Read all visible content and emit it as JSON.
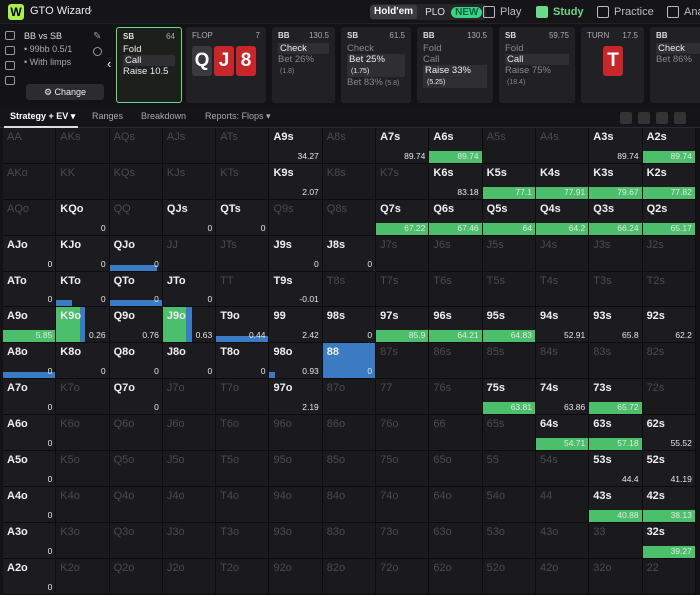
{
  "app": {
    "title": "GTO Wizard",
    "game_types": [
      "Hold'em",
      "PLO"
    ],
    "new_badge": "NEW",
    "nav": [
      {
        "label": "Play"
      },
      {
        "label": "Study",
        "active": true
      },
      {
        "label": "Practice"
      },
      {
        "label": "Ana"
      }
    ]
  },
  "setup": {
    "title": "BB vs SB",
    "stakes": "99bb 0.5/1",
    "limps": "With limps",
    "change": "Change"
  },
  "actions": [
    {
      "player": "SB",
      "pot": "64",
      "rows": [
        {
          "t": "Fold"
        },
        {
          "t": "Call",
          "on": true
        },
        {
          "t": "Raise 10.5"
        }
      ],
      "selected": true
    },
    {
      "player": "BB",
      "pot": "130.5",
      "rows": [
        {
          "t": "Check",
          "on": true
        },
        {
          "t": "Bet 26%",
          "s": "(1.8)"
        }
      ]
    },
    {
      "player": "SB",
      "pot": "61.5",
      "rows": [
        {
          "t": "Check"
        },
        {
          "t": "Bet 25%",
          "s": "(1.75)",
          "on": true
        },
        {
          "t": "Bet 83%",
          "s": "(5.8)"
        }
      ]
    },
    {
      "player": "BB",
      "pot": "130.5",
      "rows": [
        {
          "t": "Fold"
        },
        {
          "t": "Call"
        },
        {
          "t": "Raise 33%",
          "s": "(5.25)",
          "on": true
        }
      ]
    },
    {
      "player": "SB",
      "pot": "59.75",
      "rows": [
        {
          "t": "Fold"
        },
        {
          "t": "Call",
          "on": true
        },
        {
          "t": "Raise 75%",
          "s": "(18.4)"
        }
      ]
    },
    {
      "player": "BB",
      "pot": "",
      "rows": [
        {
          "t": "Check",
          "on": true
        },
        {
          "t": "Bet 86%"
        }
      ]
    }
  ],
  "flop": {
    "label": "FLOP",
    "pot": "7",
    "cards": [
      "Q",
      "J",
      "8"
    ]
  },
  "turn": {
    "label": "TURN",
    "pot": "17.5",
    "cards": [
      "T"
    ]
  },
  "tabs": [
    "Strategy + EV",
    "Ranges",
    "Breakdown",
    "Reports: Flops"
  ],
  "colors": {
    "call": "#4bbf6b",
    "raise": "#3a7bc4",
    "accent": "#6cd98a"
  },
  "grid": [
    [
      "AA",
      "AKs",
      "AQs",
      "AJs",
      "ATs",
      "A9s",
      "A8s",
      "A7s",
      "A6s",
      "A5s",
      "A4s",
      "A3s",
      "A2s"
    ],
    [
      "AKo",
      "KK",
      "KQs",
      "KJs",
      "KTs",
      "K9s",
      "K8s",
      "K7s",
      "K6s",
      "K5s",
      "K4s",
      "K3s",
      "K2s"
    ],
    [
      "AQo",
      "KQo",
      "QQ",
      "QJs",
      "QTs",
      "Q9s",
      "Q8s",
      "Q7s",
      "Q6s",
      "Q5s",
      "Q4s",
      "Q3s",
      "Q2s"
    ],
    [
      "AJo",
      "KJo",
      "QJo",
      "JJ",
      "JTs",
      "J9s",
      "J8s",
      "J7s",
      "J6s",
      "J5s",
      "J4s",
      "J3s",
      "J2s"
    ],
    [
      "ATo",
      "KTo",
      "QTo",
      "JTo",
      "TT",
      "T9s",
      "T8s",
      "T7s",
      "T6s",
      "T5s",
      "T4s",
      "T3s",
      "T2s"
    ],
    [
      "A9o",
      "K9o",
      "Q9o",
      "J9o",
      "T9o",
      "99",
      "98s",
      "97s",
      "96s",
      "95s",
      "94s",
      "93s",
      "92s"
    ],
    [
      "A8o",
      "K8o",
      "Q8o",
      "J8o",
      "T8o",
      "98o",
      "88",
      "87s",
      "86s",
      "85s",
      "84s",
      "83s",
      "82s"
    ],
    [
      "A7o",
      "K7o",
      "Q7o",
      "J7o",
      "T7o",
      "97o",
      "87o",
      "77",
      "76s",
      "75s",
      "74s",
      "73s",
      "72s"
    ],
    [
      "A6o",
      "K6o",
      "Q6o",
      "J6o",
      "T6o",
      "96o",
      "86o",
      "76o",
      "66",
      "65s",
      "64s",
      "63s",
      "62s"
    ],
    [
      "A5o",
      "K5o",
      "Q5o",
      "J5o",
      "T5o",
      "95o",
      "85o",
      "75o",
      "65o",
      "55",
      "54s",
      "53s",
      "52s"
    ],
    [
      "A4o",
      "K4o",
      "Q4o",
      "J4o",
      "T4o",
      "94o",
      "84o",
      "74o",
      "64o",
      "54o",
      "44",
      "43s",
      "42s"
    ],
    [
      "A3o",
      "K3o",
      "Q3o",
      "J3o",
      "T3o",
      "93o",
      "83o",
      "73o",
      "63o",
      "53o",
      "43o",
      "33",
      "32s"
    ],
    [
      "A2o",
      "K2o",
      "Q2o",
      "J2o",
      "T2o",
      "92o",
      "82o",
      "72o",
      "62o",
      "52o",
      "42o",
      "32o",
      "22"
    ]
  ],
  "hands": {
    "A9s": {
      "ev": "34.27"
    },
    "A7s": {
      "ev": "89.74"
    },
    "A6s": {
      "ev": "89.74",
      "call": 1
    },
    "A3s": {
      "ev": "89.74"
    },
    "A2s": {
      "ev": "89.74",
      "call": 1
    },
    "K9s": {
      "ev": "2.07"
    },
    "K6s": {
      "ev": "83.18"
    },
    "K5s": {
      "ev": "77.1",
      "call": 1
    },
    "K4s": {
      "ev": "77.91",
      "call": 1
    },
    "K3s": {
      "ev": "79.67",
      "call": 1
    },
    "K2s": {
      "ev": "77.82",
      "call": 1
    },
    "KQo": {
      "ev": "0"
    },
    "QJs": {
      "ev": "0"
    },
    "QTs": {
      "ev": "0"
    },
    "Q7s": {
      "ev": "67.22",
      "call": 1
    },
    "Q6s": {
      "ev": "67.46",
      "call": 1
    },
    "Q5s": {
      "ev": "64",
      "call": 1
    },
    "Q4s": {
      "ev": "64.2",
      "call": 1
    },
    "Q3s": {
      "ev": "66.24",
      "call": 1
    },
    "Q2s": {
      "ev": "65.17",
      "call": 1
    },
    "AJo": {
      "ev": "0"
    },
    "KJo": {
      "ev": "0"
    },
    "QJo": {
      "ev": "0",
      "raise": 0.9
    },
    "J9s": {
      "ev": "0"
    },
    "J8s": {
      "ev": "0"
    },
    "ATo": {
      "ev": "0"
    },
    "KTo": {
      "ev": "0",
      "raise": 0.3
    },
    "QTo": {
      "ev": "0",
      "raise": 1
    },
    "JTo": {
      "ev": "0"
    },
    "T9s": {
      "ev": "-0.01"
    },
    "A9o": {
      "ev": "5.85",
      "call": 1
    },
    "K9o": {
      "ev": "0.26",
      "raise": 1,
      "full": 0.55,
      "call_fill": 0.45
    },
    "Q9o": {
      "ev": "0.76"
    },
    "J9o": {
      "ev": "0.63",
      "raise": 1,
      "full": 0.55,
      "call_fill": 0.45
    },
    "T9o": {
      "ev": "0.44",
      "raise": 1
    },
    "99": {
      "ev": "2.42"
    },
    "98s": {
      "ev": "0"
    },
    "97s": {
      "ev": "85.9",
      "call": 1
    },
    "96s": {
      "ev": "64.21",
      "call": 1
    },
    "95s": {
      "ev": "64.83",
      "call": 1
    },
    "94s": {
      "ev": "52.91"
    },
    "93s": {
      "ev": "65.8"
    },
    "92s": {
      "ev": "62.2"
    },
    "A8o": {
      "ev": "0",
      "raise": 1
    },
    "K8o": {
      "ev": "0"
    },
    "Q8o": {
      "ev": "0"
    },
    "J8o": {
      "ev": "0"
    },
    "T8o": {
      "ev": "0"
    },
    "98o": {
      "ev": "0.93",
      "raise": 0.1
    },
    "88": {
      "ev": "0",
      "full": 1
    },
    "A7o": {
      "ev": "0"
    },
    "Q7o": {
      "ev": "0"
    },
    "97o": {
      "ev": "2.19"
    },
    "75s": {
      "ev": "63.81",
      "call": 1
    },
    "74s": {
      "ev": "63.86"
    },
    "73s": {
      "ev": "65.72",
      "call": 1
    },
    "A6o": {
      "ev": "0"
    },
    "64s": {
      "ev": "54.71",
      "call": 1
    },
    "63s": {
      "ev": "57.18",
      "call": 1
    },
    "62s": {
      "ev": "55.52"
    },
    "A5o": {
      "ev": "0"
    },
    "53s": {
      "ev": "44.4"
    },
    "52s": {
      "ev": "41.19"
    },
    "A4o": {
      "ev": "0"
    },
    "43s": {
      "ev": "40.88",
      "call": 1
    },
    "42s": {
      "ev": "38.13",
      "call": 1
    },
    "A3o": {
      "ev": "0"
    },
    "32s": {
      "ev": "39.27",
      "call": 1
    },
    "A2o": {
      "ev": "0"
    }
  }
}
